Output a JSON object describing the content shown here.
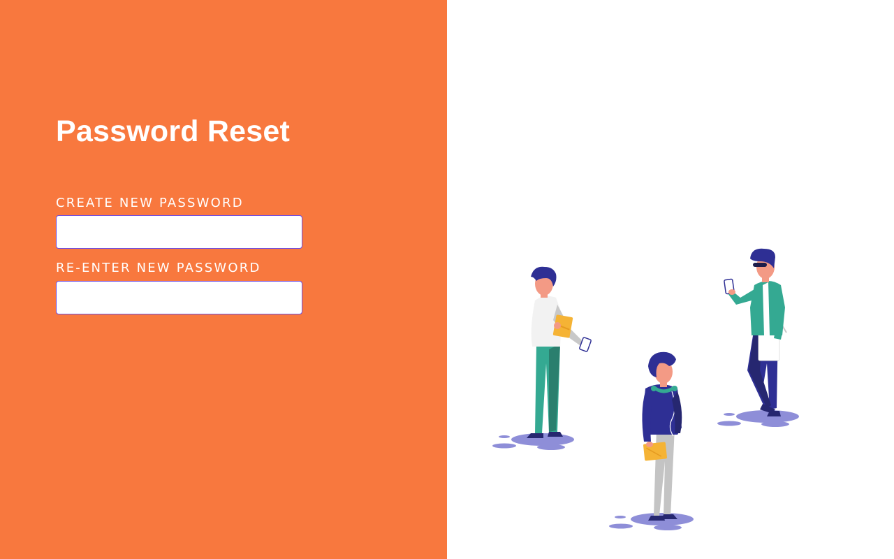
{
  "form": {
    "title": "Password Reset",
    "new_password_label": "CREATE NEW PASSWORD",
    "new_password_value": "",
    "confirm_password_label": "RE-ENTER NEW PASSWORD",
    "confirm_password_value": ""
  },
  "colors": {
    "panel_orange": "#F8783E",
    "field_border": "#6B4CE6",
    "navy": "#2E2F94",
    "teal": "#34A992",
    "shadow_purple": "#8E8ED8",
    "folder_yellow": "#F5B335",
    "skin": "#F39A85"
  },
  "illustration": {
    "name": "people-with-phones-illustration"
  }
}
